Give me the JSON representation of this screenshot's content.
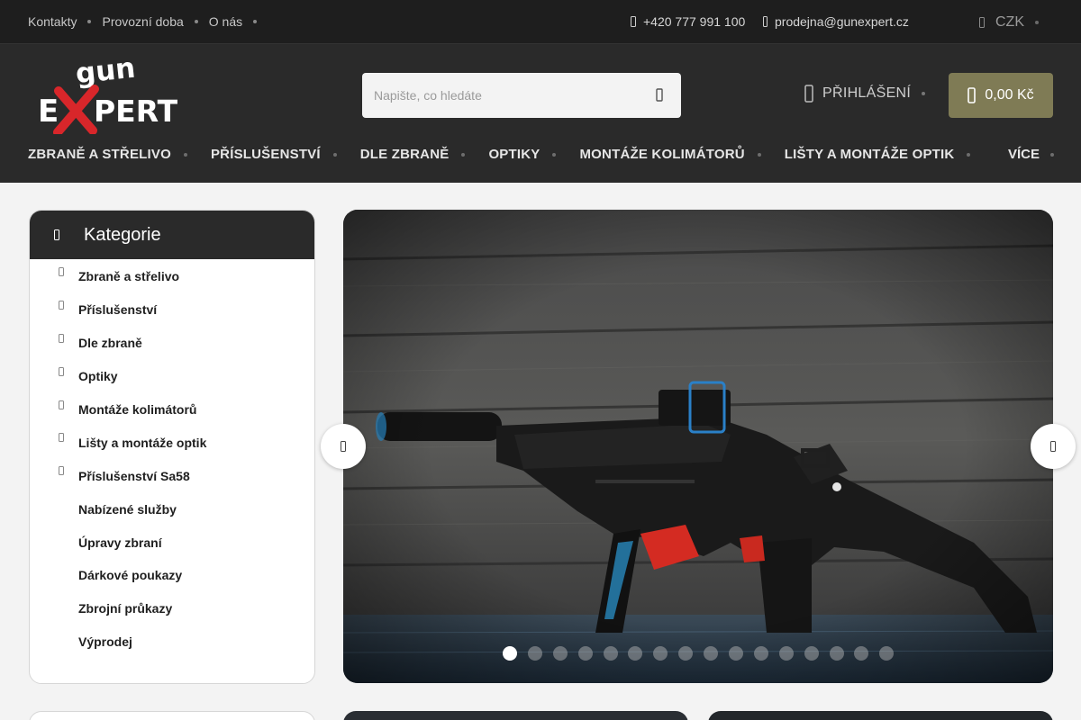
{
  "topbar": {
    "links": [
      "Kontakty",
      "Provozní doba",
      "O nás"
    ],
    "phone": "+420 777 991 100",
    "email": "prodejna@gunexpert.cz",
    "currency": "CZK"
  },
  "header": {
    "logo_text_top": "GUN",
    "logo_text_main": "EXPERT",
    "search_placeholder": "Napište, co hledáte",
    "login_label": "PŘIHLÁŠENÍ",
    "cart_total": "0,00 Kč"
  },
  "nav": {
    "items": [
      "ZBRANĚ A STŘELIVO",
      "PŘÍSLUŠENSTVÍ",
      "DLE ZBRANĚ",
      "OPTIKY",
      "MONTÁŽE KOLIMÁTORŮ",
      "LIŠTY A MONTÁŽE OPTIK"
    ],
    "more_label": "VÍCE"
  },
  "categories": {
    "title": "Kategorie",
    "items": [
      {
        "label": "Zbraně a střelivo",
        "expandable": true
      },
      {
        "label": "Příslušenství",
        "expandable": true
      },
      {
        "label": "Dle zbraně",
        "expandable": true
      },
      {
        "label": "Optiky",
        "expandable": true
      },
      {
        "label": "Montáže kolimátorů",
        "expandable": true
      },
      {
        "label": "Lišty a montáže optik",
        "expandable": true
      },
      {
        "label": "Příslušenství Sa58",
        "expandable": true
      },
      {
        "label": "Nabízené služby",
        "expandable": false
      },
      {
        "label": "Úpravy zbraní",
        "expandable": false
      },
      {
        "label": "Dárkové poukazy",
        "expandable": false
      },
      {
        "label": "Zbrojní průkazy",
        "expandable": false
      },
      {
        "label": "Výprodej",
        "expandable": false
      }
    ]
  },
  "slider": {
    "slide_count": 16,
    "active_slide": 1,
    "image_subject": "submachine gun on wooden plank background"
  },
  "colors": {
    "topbar_bg": "#1e1e1e",
    "header_bg": "#2a2a2a",
    "cart_bg": "#7f7b55",
    "page_bg": "#f3f3f3"
  }
}
